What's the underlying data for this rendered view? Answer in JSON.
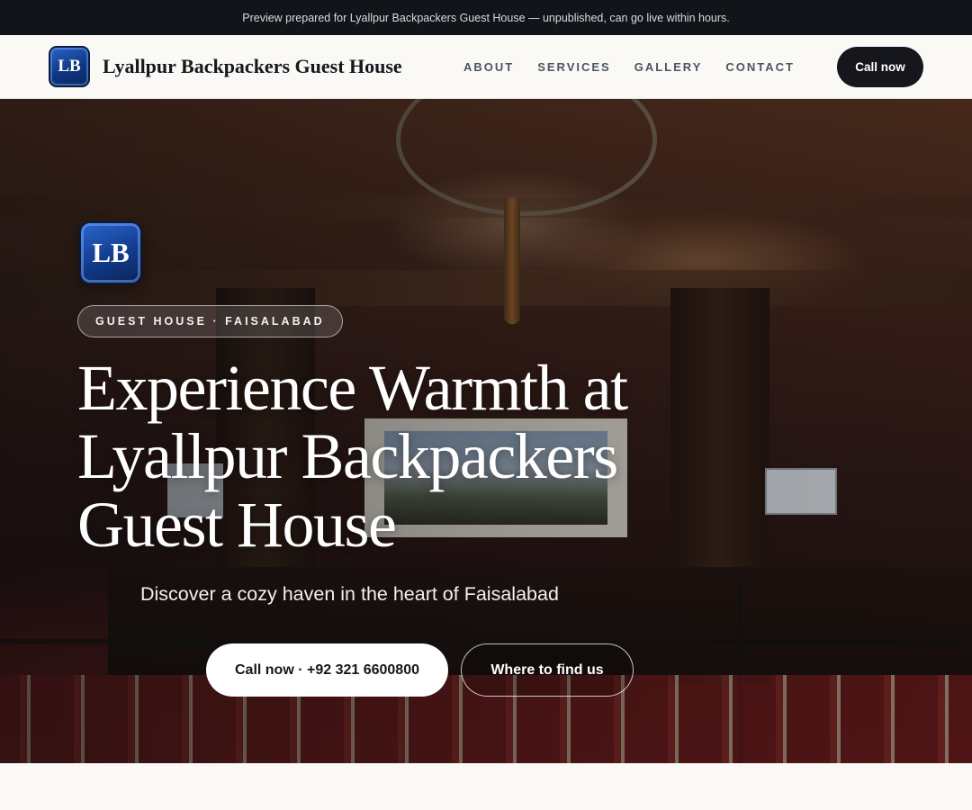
{
  "preview_banner": {
    "text": "Preview prepared for Lyallpur Backpackers Guest House — unpublished, can go live within hours."
  },
  "header": {
    "logo_text": "LB",
    "brand_name": "Lyallpur Backpackers Guest House",
    "nav": [
      {
        "label": "ABOUT"
      },
      {
        "label": "SERVICES"
      },
      {
        "label": "GALLERY"
      },
      {
        "label": "CONTACT"
      }
    ],
    "cta_label": "Call now"
  },
  "hero": {
    "logo_text": "LB",
    "tag": "GUEST HOUSE · FAISALABAD",
    "title": "Experience Warmth at Lyallpur Backpackers Guest House",
    "subtitle": "Discover a cozy haven in the heart of Faisalabad",
    "primary_button": "Call now · +92 321 6600800",
    "secondary_button": "Where to find us"
  },
  "colors": {
    "preview_bar": "#111418",
    "nav_background": "#faf9f6",
    "cta_dark": "#15171c",
    "logo_blue": "#123b8c",
    "hero_text": "#ffffff"
  }
}
